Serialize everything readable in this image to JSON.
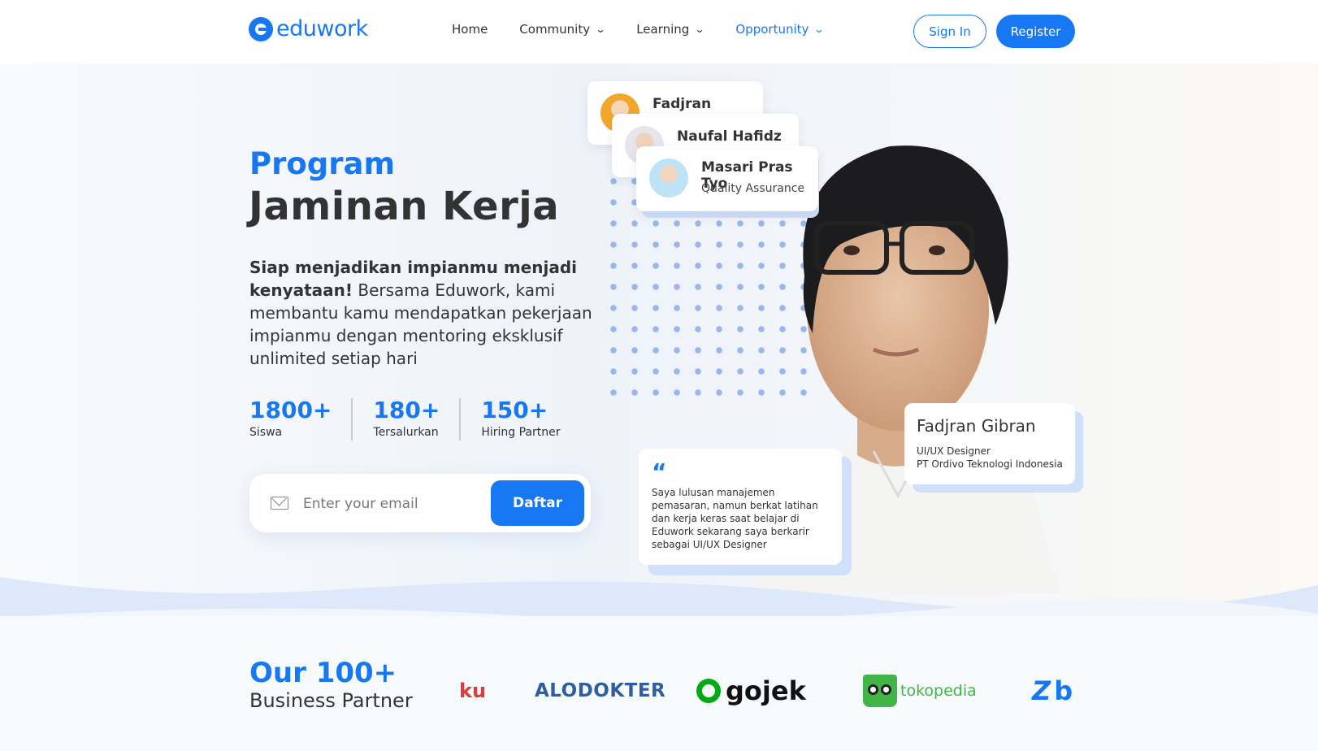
{
  "brand": {
    "name": "eduwork"
  },
  "nav": {
    "items": [
      {
        "label": "Home",
        "dropdown": false
      },
      {
        "label": "Community",
        "dropdown": true
      },
      {
        "label": "Learning",
        "dropdown": true
      },
      {
        "label": "Opportunity",
        "dropdown": true,
        "active": true
      }
    ],
    "signin_label": "Sign In",
    "register_label": "Register"
  },
  "hero": {
    "title_line1": "Program",
    "title_line2": "Jaminan Kerja",
    "desc_bold": "Siap menjadikan impianmu menjadi kenyataan!",
    "desc_rest": " Bersama Eduwork, kami membantu kamu mendapatkan pekerjaan impianmu dengan mentoring eksklusif unlimited setiap hari",
    "stats": [
      {
        "num": "1800+",
        "label": "Siswa"
      },
      {
        "num": "180+",
        "label": "Tersalurkan"
      },
      {
        "num": "150+",
        "label": "Hiring Partner"
      }
    ],
    "email_placeholder": "Enter your email",
    "daftar_label": "Daftar"
  },
  "alumni_cards": [
    {
      "name": "Fadjran Gibran"
    },
    {
      "name": "Naufal Hafidz"
    },
    {
      "name": "Masari Pras Tyo",
      "role": "Quality Assurance"
    }
  ],
  "testimonial": {
    "quote_mark": "“",
    "text": "Saya lulusan manajemen pemasaran, namun berkat latihan dan kerja keras saat belajar di Eduwork sekarang saya berkarir sebagai UI/UX Designer"
  },
  "profile": {
    "name": "Fadjran Gibran",
    "role": "UI/UX Designer",
    "company": "PT Ordivo Teknologi Indonesia"
  },
  "partners": {
    "title_line1": "Our 100+",
    "title_line2": "Business Partner",
    "logos": [
      "ku",
      "ALODOKTER",
      "gojek",
      "tokopedia",
      "b"
    ]
  },
  "colors": {
    "primary": "#1877f2",
    "text": "#333333",
    "gojek": "#00aa13",
    "tokopedia": "#42b549",
    "alodokter": "#2f5d9e",
    "kredivo_red": "#e03b3b"
  }
}
